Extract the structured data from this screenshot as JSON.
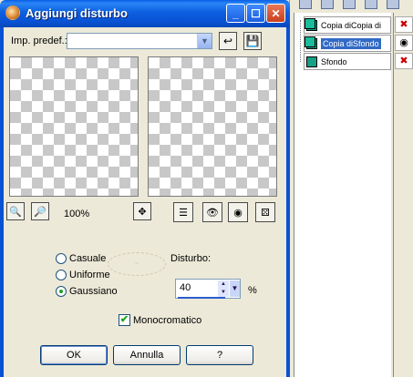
{
  "dialog": {
    "title": "Aggiungi disturbo",
    "preset_label": "Imp. predef.:",
    "preset_value": "",
    "zoom_level": "100%",
    "noise_type_options": [
      {
        "label": "Casuale",
        "selected": false
      },
      {
        "label": "Uniforme",
        "selected": false
      },
      {
        "label": "Gaussiano",
        "selected": true
      }
    ],
    "noise_label": "Disturbo:",
    "noise_value": "40",
    "noise_unit": "%",
    "monochrome_label": "Monocromatico",
    "monochrome_checked": true,
    "ok_label": "OK",
    "cancel_label": "Annulla",
    "help_label": "?"
  },
  "layers": {
    "items": [
      {
        "name": "Copia diCopia di",
        "selected": false,
        "visible_icon": "eye-crossed-icon"
      },
      {
        "name": "Copia diSfondo",
        "selected": true,
        "visible_icon": "eye-icon"
      },
      {
        "name": "Sfondo",
        "selected": false,
        "visible_icon": "eye-crossed-icon"
      }
    ]
  },
  "colors": {
    "titlebar": "#0a52d4",
    "selection": "#316ac5",
    "checker": "#c8c8c8"
  }
}
